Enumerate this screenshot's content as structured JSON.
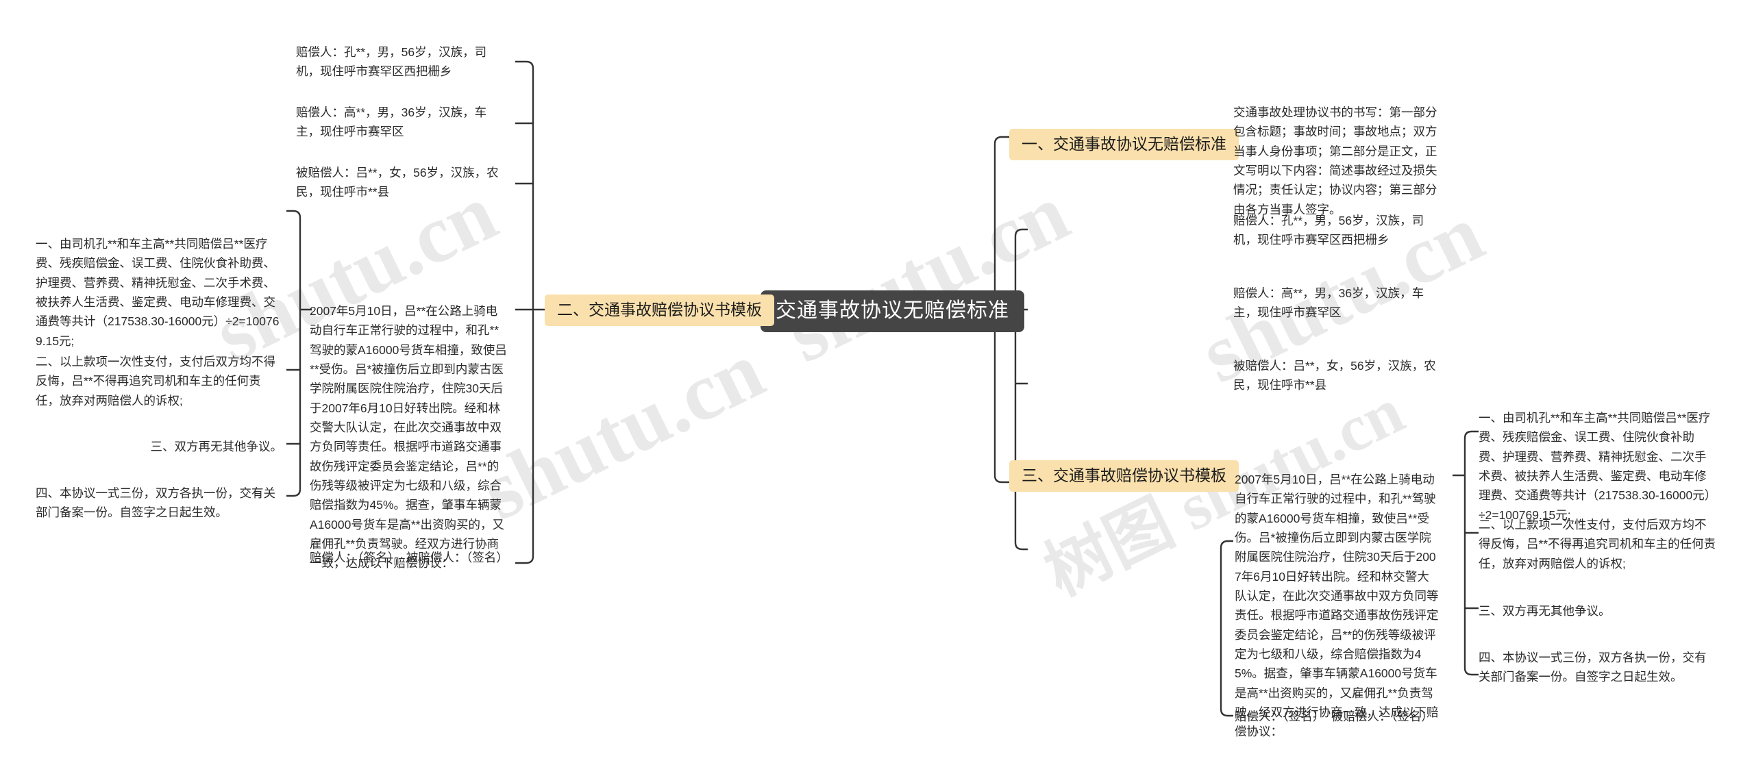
{
  "meta": {
    "watermark_text": "树图 shutu.cn",
    "watermark_fragment_a": "树图",
    "watermark_fragment_b": "shutu.cn",
    "accent_branch_color": "#FAE0AC",
    "root_color": "#454545",
    "line_color": "#333333",
    "text_color": "#2B2B2B",
    "background_color": "#FFFFFF"
  },
  "root": {
    "label": "交通事故协议无赔偿标准"
  },
  "branches": {
    "left": {
      "label": "二、交通事故赔偿协议书模板"
    },
    "right_1": {
      "label": "一、交通事故协议无赔偿标准"
    },
    "right_3": {
      "label": "三、交通事故赔偿协议书模板"
    }
  },
  "left_side": {
    "parties": [
      {
        "text": "赔偿人：孔**，男，56岁，汉族，司机，现住呼市赛罕区西把栅乡"
      },
      {
        "text": "赔偿人：高**，男，36岁，汉族，车主，现住呼市赛罕区"
      },
      {
        "text": "被赔偿人：吕**，女，56岁，汉族，农民，现住呼市**县"
      }
    ],
    "narrative": "2007年5月10日，吕**在公路上骑电动自行车正常行驶的过程中，和孔**驾驶的蒙A16000号货车相撞，致使吕**受伤。吕*被撞伤后立即到内蒙古医学院附属医院住院治疗，住院30天后于2007年6月10日好转出院。经和林交警大队认定，在此次交通事故中双方负同等责任。根据呼市道路交通事故伤残评定委员会鉴定结论，吕**的伤残等级被评定为七级和八级，综合赔偿指数为45%。据查，肇事车辆蒙A16000号货车是高**出资购买的，又雇佣孔**负责驾驶。经双方进行协商一致，达成以下赔偿协议：",
    "signature": "赔偿人：（签名）  被赔偿人：（签名）",
    "clauses": [
      {
        "text": "一、由司机孔**和车主高**共同赔偿吕**医疗费、残疾赔偿金、误工费、住院伙食补助费、护理费、营养费、精神抚慰金、二次手术费、被扶养人生活费、鉴定费、电动车修理费、交通费等共计（217538.30-16000元）÷2=100769.15元;"
      },
      {
        "text": "二、以上款项一次性支付，支付后双方均不得反悔，吕**不得再追究司机和车主的任何责任，放弃对两赔偿人的诉权;"
      },
      {
        "text": "三、双方再无其他争议。"
      },
      {
        "text": "四、本协议一式三份，双方各执一份，交有关部门备案一份。自签字之日起生效。"
      }
    ]
  },
  "right_side": {
    "branch1_detail": "交通事故处理协议书的书写：第一部分包含标题；事故时间；事故地点；双方当事人身份事项；第二部分是正文，正文写明以下内容：简述事故经过及损失情况；责任认定；协议内容；第三部分由各方当事人签字。",
    "parties": [
      {
        "text": "赔偿人：孔**，男，56岁，汉族，司机，现住呼市赛罕区西把栅乡"
      },
      {
        "text": "赔偿人：高**，男，36岁，汉族，车主，现住呼市赛罕区"
      },
      {
        "text": "被赔偿人：吕**，女，56岁，汉族，农民，现住呼市**县"
      }
    ],
    "narrative": "2007年5月10日，吕**在公路上骑电动自行车正常行驶的过程中，和孔**驾驶的蒙A16000号货车相撞，致使吕**受伤。吕*被撞伤后立即到内蒙古医学院附属医院住院治疗，住院30天后于2007年6月10日好转出院。经和林交警大队认定，在此次交通事故中双方负同等责任。根据呼市道路交通事故伤残评定委员会鉴定结论，吕**的伤残等级被评定为七级和八级，综合赔偿指数为45%。据查，肇事车辆蒙A16000号货车是高**出资购买的，又雇佣孔**负责驾驶。经双方进行协商一致，达成以下赔偿协议：",
    "signature": "赔偿人：（签名）  被赔偿人：（签名）",
    "clauses": [
      {
        "text": "一、由司机孔**和车主高**共同赔偿吕**医疗费、残疾赔偿金、误工费、住院伙食补助费、护理费、营养费、精神抚慰金、二次手术费、被扶养人生活费、鉴定费、电动车修理费、交通费等共计（217538.30-16000元）÷2=100769.15元;"
      },
      {
        "text": "二、以上款项一次性支付，支付后双方均不得反悔，吕**不得再追究司机和车主的任何责任，放弃对两赔偿人的诉权;"
      },
      {
        "text": "三、双方再无其他争议。"
      },
      {
        "text": "四、本协议一式三份，双方各执一份，交有关部门备案一份。自签字之日起生效。"
      }
    ]
  }
}
